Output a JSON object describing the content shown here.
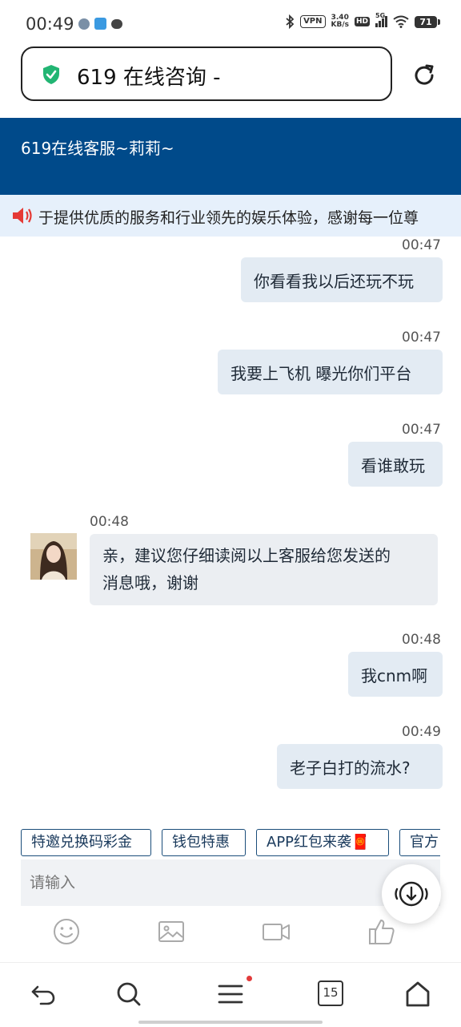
{
  "status_bar": {
    "time": "00:49",
    "vpn": "VPN",
    "speed_value": "3.40",
    "speed_unit": "KB/s",
    "hd": "HD",
    "network": "5G",
    "battery": "71"
  },
  "address_bar": {
    "title": "619 在线咨询 -"
  },
  "chat_header": {
    "title": "619在线客服~莉莉~"
  },
  "notice": {
    "text": "于提供优质的服务和行业领先的娱乐体验，感谢每一位尊"
  },
  "messages": [
    {
      "time": "00:47",
      "text": "你看看我以后还玩不玩",
      "from": "user"
    },
    {
      "time": "00:47",
      "text": "我要上飞机 曝光你们平台",
      "from": "user"
    },
    {
      "time": "00:47",
      "text": "看谁敢玩",
      "from": "user"
    },
    {
      "time": "00:48",
      "text_line1": "亲，建议您仔细读阅以上客服给您发送的",
      "text_line2": "消息哦，谢谢",
      "from": "agent"
    },
    {
      "time": "00:48",
      "text": "我cnm啊",
      "from": "user"
    },
    {
      "time": "00:49",
      "text": "老子白打的流水?",
      "from": "user"
    }
  ],
  "quick_replies": [
    "特邀兑换码彩金",
    "钱包特惠",
    "APP红包来袭🧧",
    "官方"
  ],
  "input": {
    "placeholder": "请输入"
  },
  "tools": [
    "emoji-icon",
    "image-icon",
    "video-icon",
    "thumbs-up-icon"
  ],
  "bottom_nav": {
    "tabs_count": "15"
  },
  "colors": {
    "header_bg": "#004a8a",
    "notice_bg": "#e6f0fb",
    "user_bubble": "#e3ebf3",
    "agent_bubble": "#ebeef2",
    "shield_green": "#22b573"
  }
}
